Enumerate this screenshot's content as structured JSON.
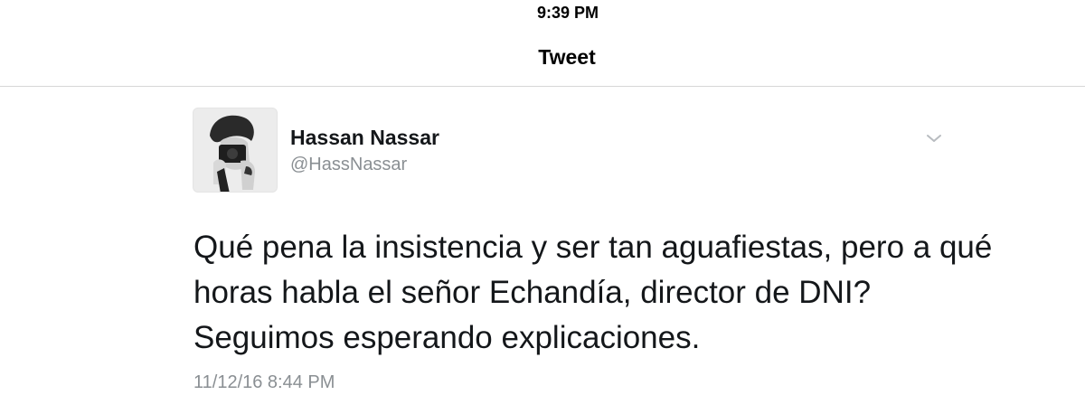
{
  "status_bar": {
    "time": "9:39 PM"
  },
  "nav": {
    "title": "Tweet"
  },
  "tweet": {
    "display_name": "Hassan Nassar",
    "handle": "@HassNassar",
    "text_lines": [
      "Qué pena la insistencia y ser tan aguafiestas, pero a qué",
      "horas habla el señor Echandía, director de DNI?",
      "Seguimos esperando explicaciones."
    ],
    "timestamp": "11/12/16 8:44 PM",
    "menu_icon": "chevron-down-icon",
    "avatar": "avatar-photo"
  },
  "colors": {
    "text": "#14171a",
    "secondary_text": "#8a8f93",
    "divider": "#d6d6d6",
    "caret": "#b8bcc0"
  }
}
